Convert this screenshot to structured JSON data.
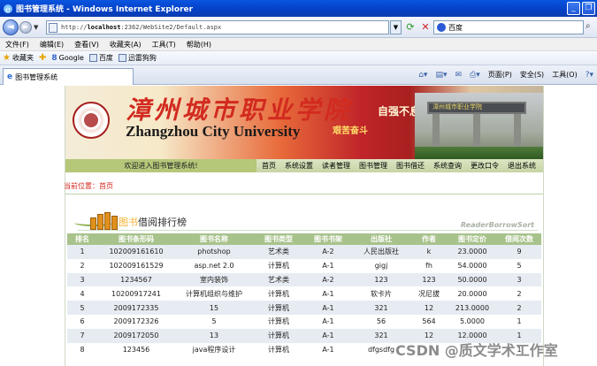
{
  "window": {
    "title": "图书管理系统 - Windows Internet Explorer",
    "min": "_",
    "restore": "❐"
  },
  "address": {
    "url_prefix": "http://",
    "url_host": "localhost",
    "url_rest": ":2362/WebSite2/Default.aspx",
    "search_text": "百度"
  },
  "menu": [
    "文件(F)",
    "编辑(E)",
    "查看(V)",
    "收藏夹(A)",
    "工具(T)",
    "帮助(H)"
  ],
  "favorites": {
    "label": "收藏夹",
    "items": [
      "Google",
      "百度",
      "迅雷狗狗"
    ]
  },
  "tab": {
    "label": "图书管理系统"
  },
  "commandbar": [
    "页面(P)",
    "安全(S)",
    "工具(O)"
  ],
  "banner": {
    "cn_name": "漳州城市职业学院",
    "en_name": "Zhangzhou City University",
    "motto1": "自强不息",
    "motto2": "艰苦奋斗",
    "gate_text": "漳州城市职业学院"
  },
  "nav": {
    "welcome": "欢迎进入图书管理系统!",
    "links": [
      "首页",
      "系统设置",
      "读者管理",
      "图书管理",
      "图书借还",
      "系统查询",
      "更改口令",
      "退出系统"
    ]
  },
  "breadcrumb": "当前位置：首页",
  "section": {
    "title_hi": "图书",
    "title": "借阅排行榜",
    "en_title": "ReaderBorrowSort"
  },
  "table": {
    "headers": [
      "排名",
      "图书条形码",
      "图书名称",
      "图书类型",
      "图书书架",
      "出版社",
      "作者",
      "图书定价",
      "借阅次数"
    ],
    "rows": [
      [
        "1",
        "102009161610",
        "photshop",
        "艺术类",
        "A-2",
        "人民出版社",
        "k",
        "23.0000",
        "9"
      ],
      [
        "2",
        "102009161529",
        "asp.net 2.0",
        "计算机",
        "A-1",
        "gigj",
        "fh",
        "54.0000",
        "5"
      ],
      [
        "3",
        "1234567",
        "室内装饰",
        "艺术类",
        "A-2",
        "123",
        "123",
        "50.0000",
        "3"
      ],
      [
        "4",
        "10200917241",
        "计算机组织与维护",
        "计算机",
        "A-1",
        "软卡片",
        "况尼拔",
        "20.0000",
        "2"
      ],
      [
        "5",
        "2009172335",
        "15",
        "计算机",
        "A-1",
        "321",
        "12",
        "213.0000",
        "2"
      ],
      [
        "6",
        "2009172326",
        "5",
        "计算机",
        "A-1",
        "56",
        "564",
        "5.0000",
        "1"
      ],
      [
        "7",
        "2009172050",
        "13",
        "计算机",
        "A-1",
        "321",
        "12",
        "12.0000",
        "1"
      ],
      [
        "8",
        "123456",
        "java程序设计",
        "计算机",
        "A-1",
        "dfgsdfg",
        "",
        "",
        "1"
      ]
    ]
  },
  "watermark": "CSDN @质文学术工作室"
}
